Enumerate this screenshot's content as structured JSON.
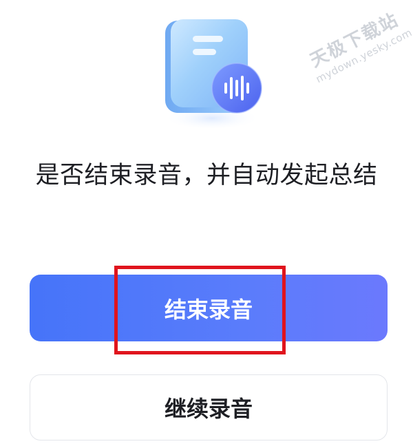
{
  "watermark": {
    "main": "天极下载站",
    "sub": "mydown.yesky.com"
  },
  "dialog": {
    "prompt": "是否结束录音，并自动发起总结",
    "primary_button": "结束录音",
    "secondary_button": "继续录音"
  },
  "illustration": {
    "icon": "voice-note-document-icon",
    "colors": {
      "document": "#9fd0fb",
      "badge": "#5b79f5"
    }
  },
  "annotation": {
    "highlight_color": "#e0141d"
  }
}
